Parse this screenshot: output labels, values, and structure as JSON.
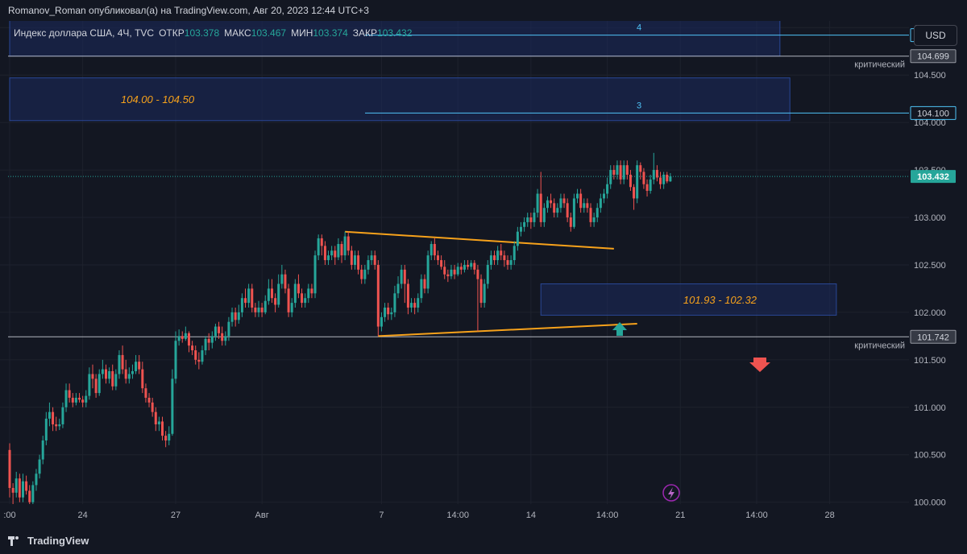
{
  "header": {
    "publisher": "Romanov_Roman опубликовал(а) на TradingView.com, Авг 20, 2023 12:44 UTC+3"
  },
  "legend": {
    "symbol": "Индекс доллара США, 4Ч, TVC",
    "open_label": "ОТКР",
    "open": "103.378",
    "high_label": "МАКС",
    "high": "103.467",
    "low_label": "МИН",
    "low": "103.374",
    "close_label": "ЗАКР",
    "close": "103.432"
  },
  "currency_button": "USD",
  "footer": {
    "brand": "TradingView"
  },
  "colors": {
    "up": "#26a69a",
    "down": "#ef5350",
    "trend": "#f7a21b",
    "zone": "#1b2a5c",
    "zone_border": "#2a4796",
    "level": "#4fc3f7"
  },
  "chart_data": {
    "type": "candlestick",
    "ylim": [
      99.98,
      105.07
    ],
    "y_ticks": [
      "100.000",
      "100.500",
      "101.000",
      "101.500",
      "102.000",
      "102.500",
      "103.000",
      "103.500",
      "104.000",
      "104.500",
      "105.000"
    ],
    "x_ticks": [
      {
        "label": ":00",
        "i": 0
      },
      {
        "label": "24",
        "i": 22
      },
      {
        "label": "27",
        "i": 50
      },
      {
        "label": "Авг",
        "i": 76
      },
      {
        "label": "7",
        "i": 112
      },
      {
        "label": "14:00",
        "i": 135
      },
      {
        "label": "14",
        "i": 157
      },
      {
        "label": "14:00",
        "i": 180
      },
      {
        "label": "21",
        "i": 202
      },
      {
        "label": "14:00",
        "i": 225
      },
      {
        "label": "28",
        "i": 247
      }
    ],
    "levels": [
      {
        "price": 104.92,
        "label": "104.920",
        "note": "4",
        "kind": "target"
      },
      {
        "price": 104.699,
        "label": "104.699",
        "note": "критический",
        "kind": "critical"
      },
      {
        "price": 104.1,
        "label": "104.100",
        "note": "3",
        "kind": "target"
      },
      {
        "price": 101.742,
        "label": "101.742",
        "note": "критический",
        "kind": "critical"
      }
    ],
    "last_price": {
      "price": 103.432,
      "label": "103.432"
    },
    "zones": [
      {
        "y1": 105.1,
        "y2": 104.7,
        "i1": 0,
        "i2": 232,
        "label": ""
      },
      {
        "y1": 104.47,
        "y2": 104.02,
        "i1": 0,
        "i2": 235,
        "label": "104.00 - 104.50"
      },
      {
        "y1": 102.3,
        "y2": 101.97,
        "i1": 160,
        "i2": 249,
        "label": "101.93 - 102.32"
      }
    ],
    "trendlines": [
      {
        "i1": 101,
        "y1": 102.85,
        "i2": 182,
        "y2": 102.67
      },
      {
        "i1": 111,
        "y1": 101.75,
        "i2": 189,
        "y2": 101.88
      }
    ],
    "candles": [
      [
        100.55,
        100.15,
        100.62,
        100.05
      ],
      [
        100.15,
        100.1,
        100.2,
        99.98
      ],
      [
        100.1,
        100.25,
        100.32,
        100.05
      ],
      [
        100.25,
        100.05,
        100.3,
        100.0
      ],
      [
        100.05,
        100.22,
        100.3,
        100.0
      ],
      [
        100.22,
        100.12,
        100.28,
        100.08
      ],
      [
        100.12,
        100.0,
        100.18,
        99.98
      ],
      [
        100.0,
        100.18,
        100.22,
        99.98
      ],
      [
        100.18,
        100.3,
        100.35,
        100.12
      ],
      [
        100.3,
        100.45,
        100.5,
        100.25
      ],
      [
        100.45,
        100.65,
        100.7,
        100.4
      ],
      [
        100.65,
        100.88,
        100.95,
        100.6
      ],
      [
        100.88,
        100.95,
        101.05,
        100.8
      ],
      [
        100.95,
        100.82,
        101.0,
        100.75
      ],
      [
        100.82,
        100.8,
        100.9,
        100.75
      ],
      [
        100.8,
        100.82,
        100.88,
        100.76
      ],
      [
        100.82,
        101.0,
        101.05,
        100.78
      ],
      [
        101.0,
        101.18,
        101.25,
        100.95
      ],
      [
        101.18,
        101.1,
        101.25,
        101.05
      ],
      [
        101.1,
        101.05,
        101.15,
        101.0
      ],
      [
        101.05,
        101.1,
        101.15,
        101.02
      ],
      [
        101.1,
        101.08,
        101.15,
        101.05
      ],
      [
        101.08,
        101.05,
        101.12,
        101.0
      ],
      [
        101.05,
        101.12,
        101.18,
        101.0
      ],
      [
        101.12,
        101.35,
        101.42,
        101.08
      ],
      [
        101.35,
        101.3,
        101.45,
        101.2
      ],
      [
        101.3,
        101.15,
        101.35,
        101.1
      ],
      [
        101.15,
        101.35,
        101.4,
        101.12
      ],
      [
        101.35,
        101.4,
        101.5,
        101.3
      ],
      [
        101.4,
        101.3,
        101.45,
        101.25
      ],
      [
        101.3,
        101.38,
        101.42,
        101.25
      ],
      [
        101.38,
        101.22,
        101.45,
        101.18
      ],
      [
        101.22,
        101.35,
        101.4,
        101.18
      ],
      [
        101.35,
        101.55,
        101.6,
        101.3
      ],
      [
        101.55,
        101.4,
        101.65,
        101.35
      ],
      [
        101.4,
        101.3,
        101.5,
        101.25
      ],
      [
        101.3,
        101.35,
        101.42,
        101.25
      ],
      [
        101.35,
        101.38,
        101.45,
        101.3
      ],
      [
        101.38,
        101.48,
        101.55,
        101.35
      ],
      [
        101.48,
        101.4,
        101.55,
        101.35
      ],
      [
        101.4,
        101.2,
        101.48,
        101.15
      ],
      [
        101.2,
        101.1,
        101.25,
        101.05
      ],
      [
        101.1,
        101.05,
        101.15,
        101.0
      ],
      [
        101.05,
        100.95,
        101.1,
        100.9
      ],
      [
        100.95,
        100.82,
        101.0,
        100.75
      ],
      [
        100.82,
        100.85,
        100.9,
        100.75
      ],
      [
        100.85,
        100.7,
        100.9,
        100.65
      ],
      [
        100.7,
        100.65,
        100.75,
        100.58
      ],
      [
        100.65,
        100.72,
        100.8,
        100.6
      ],
      [
        100.72,
        101.3,
        101.4,
        100.7
      ],
      [
        101.3,
        101.7,
        101.8,
        101.25
      ],
      [
        101.7,
        101.75,
        101.82,
        101.65
      ],
      [
        101.75,
        101.72,
        101.8,
        101.68
      ],
      [
        101.72,
        101.78,
        101.85,
        101.7
      ],
      [
        101.78,
        101.65,
        101.8,
        101.58
      ],
      [
        101.65,
        101.6,
        101.7,
        101.55
      ],
      [
        101.6,
        101.5,
        101.65,
        101.45
      ],
      [
        101.5,
        101.48,
        101.58,
        101.4
      ],
      [
        101.48,
        101.6,
        101.65,
        101.45
      ],
      [
        101.6,
        101.72,
        101.75,
        101.55
      ],
      [
        101.72,
        101.68,
        101.78,
        101.6
      ],
      [
        101.68,
        101.75,
        101.8,
        101.62
      ],
      [
        101.75,
        101.85,
        101.88,
        101.7
      ],
      [
        101.85,
        101.78,
        101.9,
        101.72
      ],
      [
        101.78,
        101.7,
        101.85,
        101.65
      ],
      [
        101.7,
        101.75,
        101.8,
        101.65
      ],
      [
        101.75,
        101.9,
        101.95,
        101.7
      ],
      [
        101.9,
        102.0,
        102.05,
        101.85
      ],
      [
        102.0,
        101.92,
        102.05,
        101.85
      ],
      [
        101.92,
        102.0,
        102.08,
        101.88
      ],
      [
        102.0,
        102.15,
        102.2,
        101.95
      ],
      [
        102.15,
        102.1,
        102.25,
        102.05
      ],
      [
        102.1,
        102.25,
        102.3,
        102.05
      ],
      [
        102.25,
        102.05,
        102.3,
        102.0
      ],
      [
        102.05,
        102.0,
        102.1,
        101.95
      ],
      [
        102.0,
        102.05,
        102.12,
        101.95
      ],
      [
        102.05,
        102.0,
        102.1,
        101.95
      ],
      [
        102.0,
        102.12,
        102.18,
        101.98
      ],
      [
        102.12,
        102.25,
        102.35,
        102.08
      ],
      [
        102.25,
        102.15,
        102.35,
        102.1
      ],
      [
        102.15,
        102.08,
        102.2,
        102.0
      ],
      [
        102.08,
        102.3,
        102.4,
        102.05
      ],
      [
        102.3,
        102.4,
        102.5,
        102.25
      ],
      [
        102.4,
        102.25,
        102.45,
        102.2
      ],
      [
        102.25,
        102.0,
        102.3,
        101.95
      ],
      [
        102.0,
        102.1,
        102.15,
        101.95
      ],
      [
        102.1,
        102.3,
        102.35,
        102.05
      ],
      [
        102.3,
        102.2,
        102.4,
        102.15
      ],
      [
        102.2,
        102.1,
        102.25,
        102.05
      ],
      [
        102.1,
        102.15,
        102.2,
        102.05
      ],
      [
        102.15,
        102.25,
        102.3,
        102.1
      ],
      [
        102.25,
        102.2,
        102.3,
        102.15
      ],
      [
        102.2,
        102.6,
        102.65,
        102.15
      ],
      [
        102.6,
        102.78,
        102.82,
        102.55
      ],
      [
        102.78,
        102.7,
        102.82,
        102.6
      ],
      [
        102.7,
        102.55,
        102.75,
        102.5
      ],
      [
        102.55,
        102.6,
        102.65,
        102.5
      ],
      [
        102.6,
        102.65,
        102.7,
        102.55
      ],
      [
        102.65,
        102.58,
        102.7,
        102.5
      ],
      [
        102.58,
        102.72,
        102.78,
        102.55
      ],
      [
        102.72,
        102.6,
        102.75,
        102.52
      ],
      [
        102.6,
        102.8,
        102.85,
        102.55
      ],
      [
        102.8,
        102.65,
        102.85,
        102.6
      ],
      [
        102.65,
        102.5,
        102.7,
        102.45
      ],
      [
        102.5,
        102.6,
        102.65,
        102.45
      ],
      [
        102.6,
        102.45,
        102.65,
        102.4
      ],
      [
        102.45,
        102.35,
        102.5,
        102.3
      ],
      [
        102.35,
        102.45,
        102.5,
        102.3
      ],
      [
        102.45,
        102.55,
        102.6,
        102.4
      ],
      [
        102.55,
        102.6,
        102.65,
        102.5
      ],
      [
        102.6,
        102.5,
        102.65,
        102.45
      ],
      [
        102.5,
        101.85,
        102.55,
        101.75
      ],
      [
        101.85,
        101.95,
        102.0,
        101.8
      ],
      [
        101.95,
        102.05,
        102.1,
        101.9
      ],
      [
        102.05,
        101.98,
        102.1,
        101.92
      ],
      [
        101.98,
        102.0,
        102.05,
        101.92
      ],
      [
        102.0,
        102.2,
        102.28,
        101.95
      ],
      [
        102.2,
        102.3,
        102.38,
        102.15
      ],
      [
        102.3,
        102.45,
        102.5,
        102.25
      ],
      [
        102.45,
        102.3,
        102.5,
        102.1
      ],
      [
        102.3,
        102.05,
        102.35,
        101.98
      ],
      [
        102.05,
        102.1,
        102.15,
        102.0
      ],
      [
        102.1,
        102.05,
        102.15,
        101.98
      ],
      [
        102.05,
        102.15,
        102.2,
        102.0
      ],
      [
        102.15,
        102.35,
        102.4,
        102.1
      ],
      [
        102.35,
        102.25,
        102.4,
        102.2
      ],
      [
        102.25,
        102.6,
        102.65,
        102.2
      ],
      [
        102.6,
        102.72,
        102.75,
        102.55
      ],
      [
        102.72,
        102.6,
        102.78,
        102.55
      ],
      [
        102.6,
        102.55,
        102.65,
        102.5
      ],
      [
        102.55,
        102.48,
        102.6,
        102.45
      ],
      [
        102.48,
        102.4,
        102.55,
        102.35
      ],
      [
        102.4,
        102.38,
        102.45,
        102.32
      ],
      [
        102.38,
        102.45,
        102.5,
        102.35
      ],
      [
        102.45,
        102.4,
        102.5,
        102.35
      ],
      [
        102.4,
        102.48,
        102.52,
        102.38
      ],
      [
        102.48,
        102.45,
        102.52,
        102.4
      ],
      [
        102.45,
        102.5,
        102.55,
        102.42
      ],
      [
        102.5,
        102.48,
        102.55,
        102.45
      ],
      [
        102.48,
        102.52,
        102.55,
        102.45
      ],
      [
        102.52,
        102.45,
        102.55,
        102.4
      ],
      [
        102.45,
        102.35,
        102.5,
        101.8
      ],
      [
        102.35,
        102.1,
        102.4,
        102.05
      ],
      [
        102.1,
        102.3,
        102.35,
        102.05
      ],
      [
        102.3,
        102.5,
        102.55,
        102.25
      ],
      [
        102.5,
        102.6,
        102.65,
        102.45
      ],
      [
        102.6,
        102.55,
        102.65,
        102.5
      ],
      [
        102.55,
        102.65,
        102.7,
        102.5
      ],
      [
        102.65,
        102.6,
        102.72,
        102.55
      ],
      [
        102.6,
        102.55,
        102.65,
        102.48
      ],
      [
        102.55,
        102.5,
        102.6,
        102.45
      ],
      [
        102.5,
        102.55,
        102.6,
        102.45
      ],
      [
        102.55,
        102.7,
        102.75,
        102.5
      ],
      [
        102.7,
        102.85,
        102.9,
        102.65
      ],
      [
        102.85,
        102.9,
        102.95,
        102.8
      ],
      [
        102.9,
        102.95,
        103.0,
        102.85
      ],
      [
        102.95,
        103.0,
        103.05,
        102.9
      ],
      [
        103.0,
        102.95,
        103.05,
        102.88
      ],
      [
        102.95,
        103.05,
        103.1,
        102.9
      ],
      [
        103.05,
        103.25,
        103.3,
        103.0
      ],
      [
        103.25,
        102.95,
        103.48,
        102.9
      ],
      [
        102.95,
        103.1,
        103.15,
        102.9
      ],
      [
        103.1,
        103.18,
        103.22,
        103.05
      ],
      [
        103.18,
        103.15,
        103.25,
        103.1
      ],
      [
        103.15,
        103.05,
        103.2,
        103.0
      ],
      [
        103.05,
        103.1,
        103.15,
        103.0
      ],
      [
        103.1,
        103.2,
        103.25,
        103.05
      ],
      [
        103.2,
        103.15,
        103.25,
        103.1
      ],
      [
        103.15,
        103.0,
        103.2,
        102.95
      ],
      [
        103.0,
        102.9,
        103.05,
        102.85
      ],
      [
        102.9,
        103.2,
        103.25,
        102.88
      ],
      [
        103.2,
        103.25,
        103.3,
        103.15
      ],
      [
        103.25,
        103.1,
        103.3,
        103.05
      ],
      [
        103.1,
        103.15,
        103.2,
        103.05
      ],
      [
        103.15,
        103.1,
        103.2,
        103.05
      ],
      [
        103.1,
        102.95,
        103.15,
        102.9
      ],
      [
        102.95,
        103.0,
        103.05,
        102.9
      ],
      [
        103.0,
        103.1,
        103.15,
        102.95
      ],
      [
        103.1,
        103.2,
        103.25,
        103.05
      ],
      [
        103.2,
        103.25,
        103.3,
        103.15
      ],
      [
        103.25,
        103.35,
        103.42,
        103.2
      ],
      [
        103.35,
        103.5,
        103.55,
        103.3
      ],
      [
        103.5,
        103.45,
        103.55,
        103.4
      ],
      [
        103.45,
        103.55,
        103.6,
        103.4
      ],
      [
        103.55,
        103.4,
        103.6,
        103.35
      ],
      [
        103.4,
        103.55,
        103.6,
        103.35
      ],
      [
        103.55,
        103.45,
        103.6,
        103.4
      ],
      [
        103.45,
        103.32,
        103.5,
        103.28
      ],
      [
        103.32,
        103.2,
        103.35,
        103.08
      ],
      [
        103.2,
        103.55,
        103.6,
        103.15
      ],
      [
        103.55,
        103.48,
        103.58,
        103.4
      ],
      [
        103.48,
        103.35,
        103.52,
        103.3
      ],
      [
        103.35,
        103.28,
        103.4,
        103.22
      ],
      [
        103.28,
        103.4,
        103.45,
        103.25
      ],
      [
        103.4,
        103.5,
        103.68,
        103.35
      ],
      [
        103.5,
        103.42,
        103.55,
        103.38
      ],
      [
        103.42,
        103.35,
        103.48,
        103.3
      ],
      [
        103.35,
        103.45,
        103.48,
        103.3
      ],
      [
        103.45,
        103.38,
        103.48,
        103.36
      ],
      [
        103.38,
        103.432,
        103.467,
        103.374
      ]
    ]
  }
}
